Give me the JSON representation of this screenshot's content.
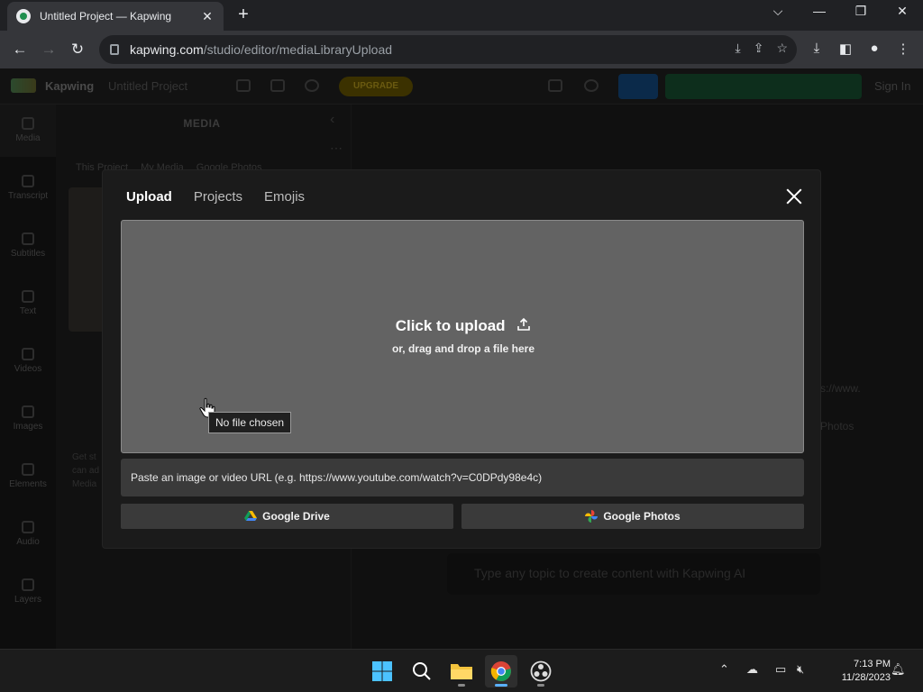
{
  "browser": {
    "tab_title": "Untitled Project — Kapwing",
    "url_host": "kapwing.com",
    "url_path": "/studio/editor/mediaLibraryUpload"
  },
  "app": {
    "brand": "Kapwing",
    "project_name": "Untitled Project",
    "upgrade_label": "UPGRADE",
    "signin_label": "Sign In",
    "sidebar": [
      {
        "label": "Media",
        "icon": "media-icon"
      },
      {
        "label": "Transcript",
        "icon": "transcript-icon"
      },
      {
        "label": "Subtitles",
        "icon": "subtitles-icon"
      },
      {
        "label": "Text",
        "icon": "text-icon"
      },
      {
        "label": "Videos",
        "icon": "videos-icon"
      },
      {
        "label": "Images",
        "icon": "images-icon"
      },
      {
        "label": "Elements",
        "icon": "elements-icon"
      },
      {
        "label": "Audio",
        "icon": "audio-icon"
      },
      {
        "label": "Layers",
        "icon": "layers-icon"
      }
    ],
    "media_panel": {
      "title": "MEDIA",
      "tabs": [
        "This Project",
        "My Media",
        "Google Photos"
      ],
      "note": "Get st can ad Media"
    },
    "background_right": {
      "url_fragment": "s://www.",
      "photos_fragment": "Photos"
    },
    "ai_prompt_placeholder": "Type any topic to create content with Kapwing AI"
  },
  "modal": {
    "tabs": [
      {
        "label": "Upload",
        "active": true
      },
      {
        "label": "Projects",
        "active": false
      },
      {
        "label": "Emojis",
        "active": false
      }
    ],
    "dropzone": {
      "title": "Click to upload",
      "subtitle": "or, drag and drop a file here",
      "tooltip": "No file chosen"
    },
    "url_placeholder": "Paste an image or video URL (e.g. https://www.youtube.com/watch?v=C0DPdy98e4c)",
    "google_drive_label": "Google Drive",
    "google_photos_label": "Google Photos"
  },
  "taskbar": {
    "time": "7:13 PM",
    "date": "11/28/2023"
  }
}
